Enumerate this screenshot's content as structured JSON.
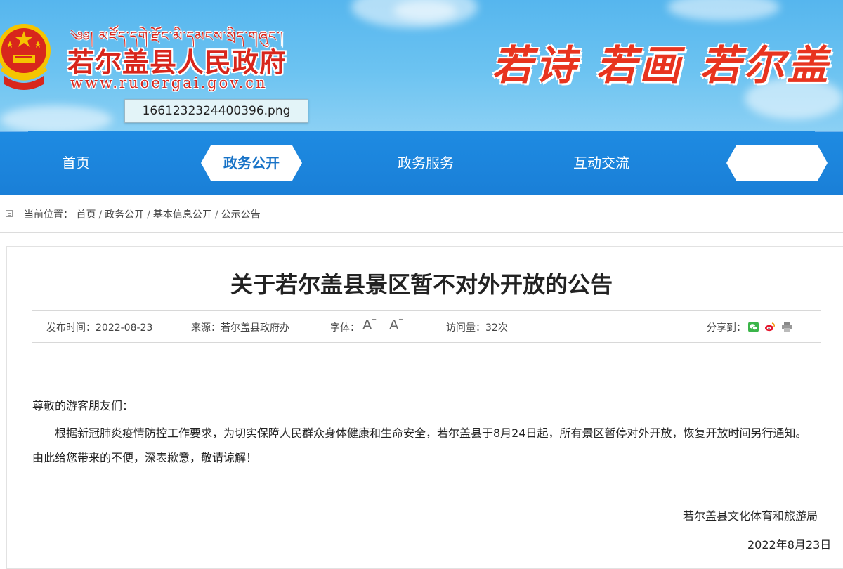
{
  "header": {
    "tibetan_line": "༄༅། མཛོད་དགེ་རྫོང་མི་དམངས་སྲིད་གཞུང་།",
    "site_title": "若尔盖县人民政府",
    "site_url": "www.ruoergai.gov.cn",
    "file_tooltip": "1661232324400396.png",
    "slogan": "若诗 若画 若尔盖"
  },
  "nav": {
    "items": [
      {
        "label": "首页"
      },
      {
        "label": "政务公开",
        "active": true
      },
      {
        "label": "政务服务"
      },
      {
        "label": "互动交流"
      },
      {
        "label": ""
      }
    ]
  },
  "breadcrumb": {
    "prefix": "当前位置：",
    "items": [
      "首页",
      "政务公开",
      "基本信息公开",
      "公示公告"
    ]
  },
  "article": {
    "title": "关于若尔盖县景区暂不对外开放的公告",
    "meta": {
      "publish_time": "发布时间：2022-08-23",
      "source": "来源：若尔盖县政府办",
      "font_size_label": "字体：",
      "font_increase": "A",
      "font_decrease": "A",
      "views": "访问量：32次",
      "share_label": "分享到："
    },
    "greeting": "尊敬的游客朋友们：",
    "paragraph_line1": "根据新冠肺炎疫情防控工作要求，为切实保障人民群众身体健康和生命安全，若尔盖县于8月24日起，所有景区暂停对外开放，恢复开放时间另行通知。",
    "paragraph_line2": "由此给您带来的不便，深表歉意，敬请谅解！",
    "signature": "若尔盖县文化体育和旅游局",
    "date": "2022年8月23日"
  },
  "colors": {
    "header_sky": "#56b6ee",
    "nav_blue": "#1e8be2",
    "brand_red": "#d8261c",
    "share_wechat": "#3bb54a",
    "share_weibo": "#e6162d"
  },
  "icons": {
    "emblem": "national-emblem",
    "breadcrumb": "location-icon",
    "font_up": "font-increase-icon",
    "font_down": "font-decrease-icon",
    "share": [
      "wechat-icon",
      "weibo-icon",
      "print-icon"
    ]
  }
}
